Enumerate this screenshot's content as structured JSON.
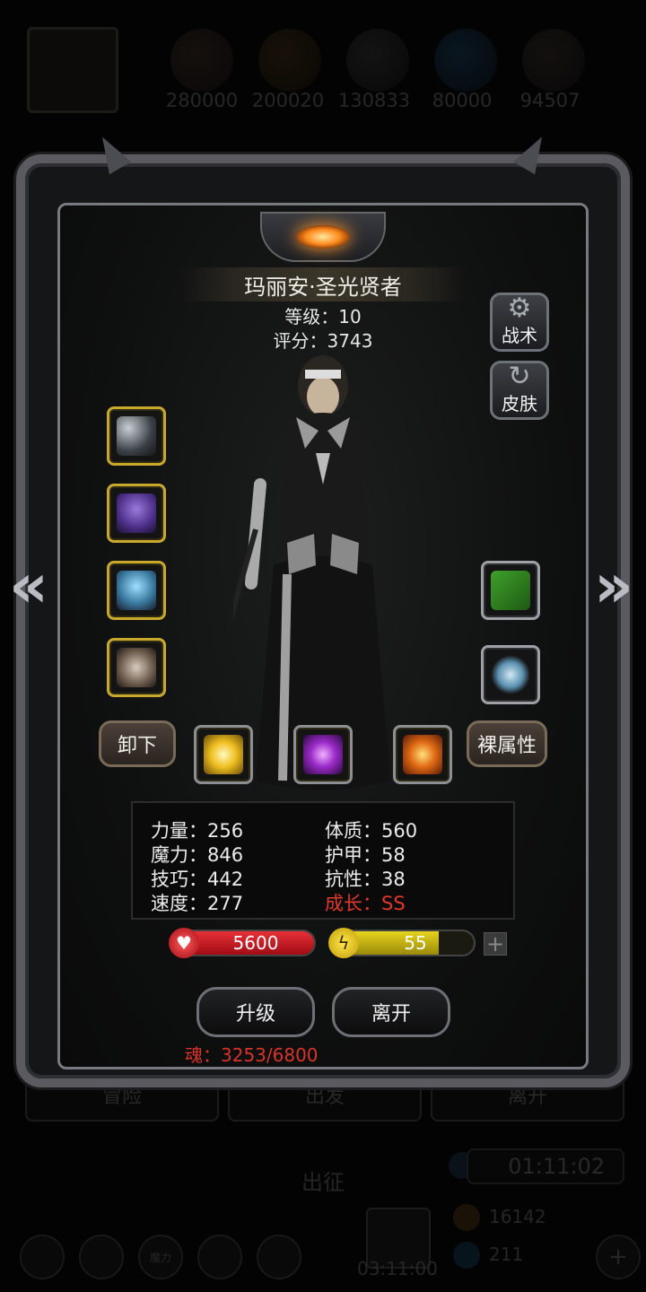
{
  "resources": [
    {
      "value": "280000",
      "icon": "rock-resource-icon",
      "color": "#7a3a22"
    },
    {
      "value": "200020",
      "icon": "wood-resource-icon",
      "color": "#6a4418"
    },
    {
      "value": "130833",
      "icon": "iron-resource-icon",
      "color": "#4a4a4a"
    },
    {
      "value": "80000",
      "icon": "crystal-resource-icon",
      "color": "#1e5a88"
    },
    {
      "value": "94507",
      "icon": "stone-resource-icon",
      "color": "#4a3a3a"
    }
  ],
  "background": {
    "buttons": [
      "冒险",
      "出发",
      "离开"
    ],
    "expedition_label": "出征",
    "timer_top": "01:11:02",
    "timer_bottom": "03:11:00",
    "counter_gold": "16142",
    "counter_gem": "211",
    "round_btn_label": "魔力"
  },
  "hero": {
    "name": "玛丽安·圣光贤者",
    "level_label": "等级：10",
    "score_label": "评分：3743"
  },
  "side_buttons": {
    "tactics": "战术",
    "skin": "皮肤"
  },
  "actions": {
    "unequip": "卸下",
    "base_attributes": "裸属性",
    "upgrade": "升级",
    "leave": "离开"
  },
  "stats": {
    "strength": "力量：256",
    "magic": "魔力：846",
    "skill": "技巧：442",
    "speed": "速度：277",
    "constitution": "体质：560",
    "armor": "护甲：58",
    "resistance": "抗性：38",
    "growth": "成长：SS"
  },
  "bars": {
    "hp": "5600",
    "energy": "55",
    "energy_level": 0.75,
    "hp_level": 1.0
  },
  "soul": "魂：3253/6800",
  "colors": {
    "gold_border": "#c9a92c",
    "hp_red": "#c8141c",
    "energy_yellow": "#c8b80c",
    "soul_red": "#d8342a"
  }
}
